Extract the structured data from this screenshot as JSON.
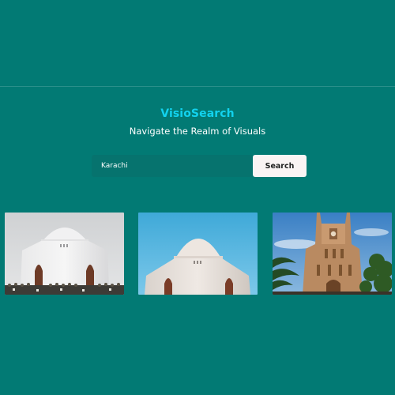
{
  "app": {
    "title": "VisioSearch",
    "tagline": "Navigate the Realm of Visuals"
  },
  "search": {
    "value": "Karachi",
    "placeholder": "",
    "button_label": "Search"
  },
  "results": [
    {
      "subject": "white mausoleum dome with crowd, overcast sky"
    },
    {
      "subject": "white mausoleum dome against blue sky"
    },
    {
      "subject": "sandstone gothic clock tower with palm trees"
    }
  ],
  "colors": {
    "background": "#027a74",
    "title": "#12d2ee",
    "tagline": "#ffffff",
    "input_bg": "#06736e",
    "button_bg": "#faf4f4"
  }
}
